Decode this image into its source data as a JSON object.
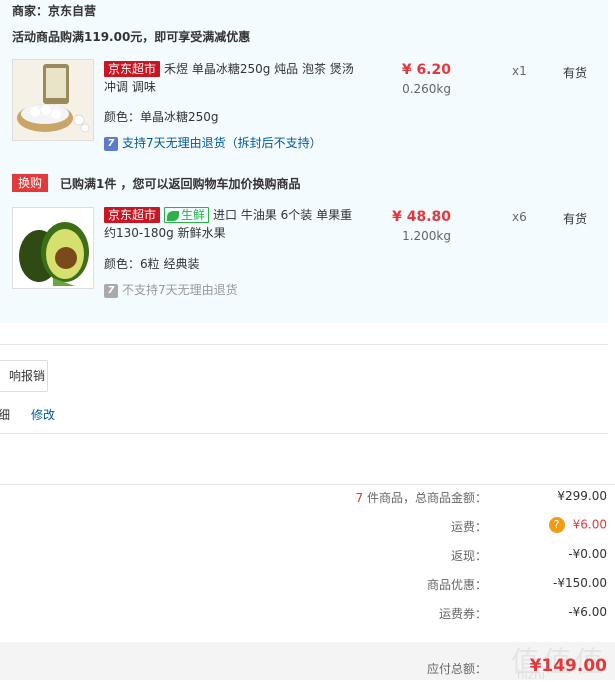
{
  "seller": "商家：京东自营",
  "promo_banner": "活动商品购满119.00元，即可享受满减优惠",
  "items": [
    {
      "store_tag": "京东超市",
      "title": "禾煜 单晶冰糖250g 炖品 泡茶 煲汤 冲调 调味",
      "price": "¥ 6.20",
      "weight": "0.260kg",
      "qty": "x1",
      "stock": "有货",
      "spec": "颜色：单晶冰糖250g",
      "return_badge": "7",
      "return_policy": "支持7天无理由退货（拆封后不支持）"
    },
    {
      "store_tag": "京东超市",
      "fresh_tag": "生鲜",
      "title": "进口 牛油果 6个装 单果重约130-180g 新鲜水果",
      "price": "¥ 48.80",
      "weight": "1.200kg",
      "qty": "x6",
      "stock": "有货",
      "spec": "颜色：6粒 经典装",
      "return_badge": "7",
      "return_policy": "不支持7天无理由退货"
    }
  ],
  "swap": {
    "tag": "换购",
    "text": "已购满1件 ，您可以返回购物车加价换购商品"
  },
  "reimburse_button": "响报销",
  "detail_link_partial": "细",
  "edit_link": "修改",
  "summary": {
    "count": "7",
    "count_suffix": "件商品，总商品金额：",
    "total_goods": "¥299.00",
    "shipping_label": "运费：",
    "shipping_icon": "?",
    "shipping_value": "¥6.00",
    "rebate_label": "返现：",
    "rebate_value": "-¥0.00",
    "discount_label": "商品优惠：",
    "discount_value": "-¥150.00",
    "ship_coupon_label": "运费券：",
    "ship_coupon_value": "-¥6.00"
  },
  "payable_label": "应付总额：",
  "payable_value": "¥149.00",
  "watermark": "值值值",
  "watermark_sub": "hizhi"
}
